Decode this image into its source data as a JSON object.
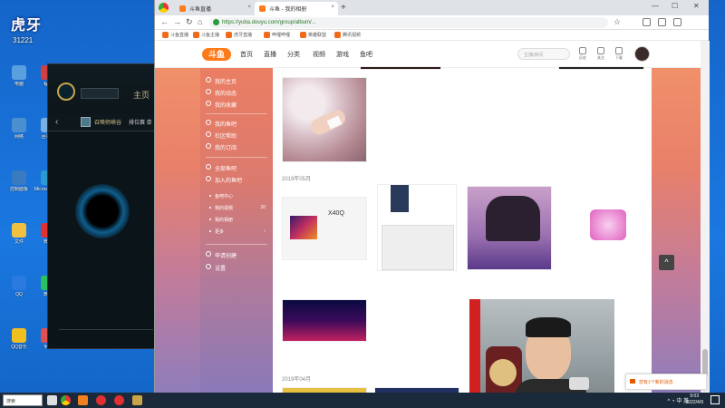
{
  "desktop": {
    "brand": "虎牙",
    "brand_sub": "31221",
    "icons": [
      {
        "label": "电脑",
        "color": "#5aa0e0"
      },
      {
        "label": "程序",
        "color": "#d04040"
      },
      {
        "label": "网络",
        "color": "#4a90d0"
      },
      {
        "label": "回收站",
        "color": "#7ab0e0"
      },
      {
        "label": "控制面板",
        "color": "#3a7ac0"
      },
      {
        "label": "Microsoft Edge",
        "color": "#2a9ad0"
      },
      {
        "label": "文件",
        "color": "#f0c040"
      },
      {
        "label": "微博",
        "color": "#e03030"
      },
      {
        "label": "QQ",
        "color": "#2a7ae0"
      },
      {
        "label": "微信",
        "color": "#2ac060"
      },
      {
        "label": "QQ音乐",
        "color": "#f0c020"
      },
      {
        "label": "手机",
        "color": "#e05050"
      }
    ]
  },
  "game": {
    "home": "主页",
    "mode": "召唤师峡谷",
    "rank": "排位赛 单"
  },
  "browser": {
    "tabs": [
      {
        "title": "斗鱼直播"
      },
      {
        "title": "斗鱼 - 我的相册"
      }
    ],
    "new_tab": "+",
    "url": "https://yuba.douyu.com/group/album/...",
    "bookmarks": [
      "斗鱼直播",
      "斗鱼主播",
      "虎牙直播",
      "哔哩哔哩",
      "英雄联盟",
      "腾讯视频"
    ]
  },
  "site": {
    "logo": "斗鱼",
    "nav": [
      "首页",
      "直播",
      "分类",
      "视频",
      "游戏",
      "鱼吧"
    ],
    "search_placeholder": "主播/房间",
    "tools": [
      "历史",
      "关注",
      "下载"
    ],
    "sidebar": [
      {
        "label": "我的主页"
      },
      {
        "label": "我的动态"
      },
      {
        "label": "我的收藏"
      },
      {
        "label": "我的鱼吧"
      },
      {
        "label": "社区帮助"
      },
      {
        "label": "我的订阅"
      },
      {
        "label": "全部鱼吧"
      },
      {
        "label": "加入的鱼吧"
      }
    ],
    "sidebar_sub": [
      {
        "label": "鱼吧中心",
        "count": ""
      },
      {
        "label": "我的视频",
        "count": "20"
      },
      {
        "label": "我的相册",
        "count": ""
      },
      {
        "label": "更多",
        "count": ""
      }
    ],
    "sidebar_bottom": [
      {
        "label": "申请创建"
      },
      {
        "label": "设置"
      }
    ],
    "months": [
      "2019年05月",
      "2019年04月"
    ],
    "scroll_top": "^",
    "notify": "您有1个新的消息"
  },
  "taskbar": {
    "search": "搜索",
    "tray": "^ ◔ 中 英",
    "time": "9:03",
    "date": "2022/4/9"
  },
  "colors": {
    "accent": "#ff7a1a",
    "sidebar_top": "#eb7e63",
    "sidebar_bottom": "#8a79b9"
  }
}
